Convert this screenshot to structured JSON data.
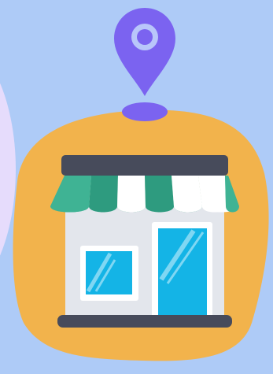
{
  "scene": {
    "subject": "storefront",
    "marker": "location-pin",
    "colors": {
      "background": "#aecbf7",
      "side_blob": "#e6dcfc",
      "orange_blob": "#f2b34c",
      "pin": "#7b63f0",
      "pin_inner": "#b9c6fa",
      "roof_dark": "#474b5b",
      "awning_green": "#2e9b7f",
      "awning_green_light": "#3fb394",
      "awning_white": "#ffffff",
      "wall": "#e3e6ec",
      "glass": "#14b4e6",
      "frame": "#ffffff"
    }
  }
}
